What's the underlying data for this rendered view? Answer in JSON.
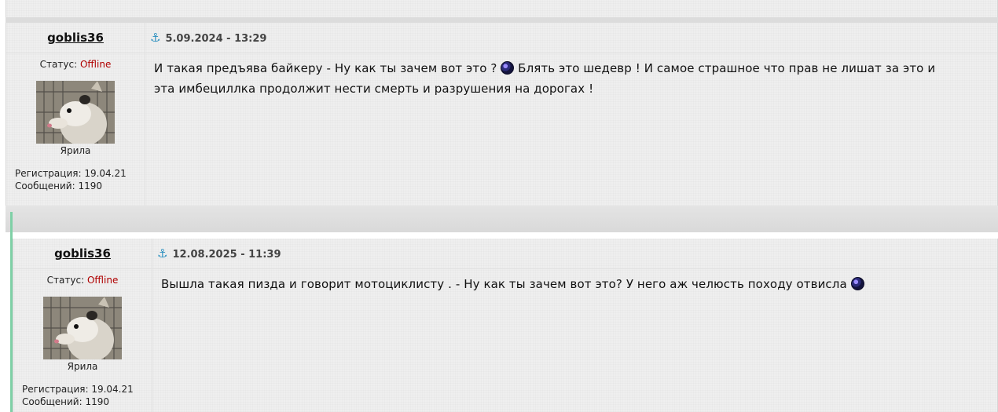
{
  "posts": [
    {
      "username": "goblis36",
      "status_label": "Статус: ",
      "status_value": "Offline",
      "rank": "Ярила",
      "reg_label": "Регистрация: ",
      "reg_date": "19.04.21",
      "msgs_label": "Сообщений: ",
      "msgs_count": "1190",
      "anchor_icon": "anchor-icon",
      "date": "5.09.2024 - 13:29",
      "text_part1": "И такая предъява байкеру - Ну как ты зачем вот это ?",
      "text_part2": " Блять это шедевр ! И самое страшное что прав не лишат за это и эта имбециллка продолжит нести смерть и разрушения на дорогах !"
    },
    {
      "username": "goblis36",
      "status_label": "Статус: ",
      "status_value": "Offline",
      "rank": "Ярила",
      "reg_label": "Регистрация: ",
      "reg_date": "19.04.21",
      "msgs_label": "Сообщений: ",
      "msgs_count": "1190",
      "anchor_icon": "anchor-icon",
      "date": "12.08.2025 - 11:39",
      "text_part1": "Вышла такая пизда и говорит мотоциклисту . - Ну как ты зачем вот это? У него аж челюсть походу отвисла",
      "text_part2": ""
    }
  ],
  "colors": {
    "offline": "#b00000",
    "anchor": "#2a8fbf",
    "post_bg": "#efefef"
  }
}
